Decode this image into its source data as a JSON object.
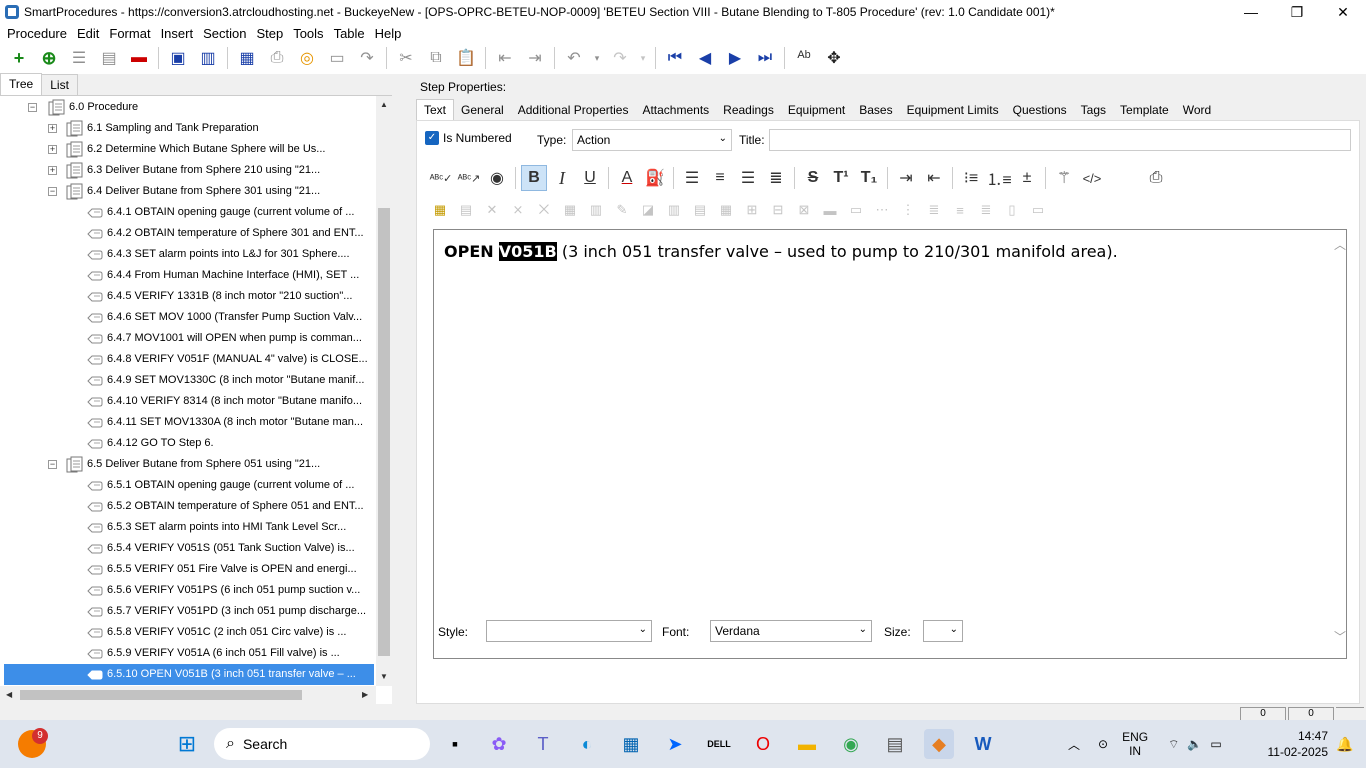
{
  "window": {
    "title": "SmartProcedures - https://conversion3.atrcloudhosting.net - BuckeyeNew - [OPS-OPRC-BETEU-NOP-0009] 'BETEU Section VIII - Butane Blending to T-805 Procedure' (rev: 1.0 Candidate 001)*"
  },
  "menu": [
    "Procedure",
    "Edit",
    "Format",
    "Insert",
    "Section",
    "Step",
    "Tools",
    "Table",
    "Help"
  ],
  "left_tabs": [
    "Tree",
    "List"
  ],
  "tree": [
    {
      "label": "6.0 Procedure",
      "level": 0,
      "exp": "−",
      "kind": "section"
    },
    {
      "label": "6.1 Sampling and Tank Preparation",
      "level": 1,
      "exp": "+",
      "kind": "section"
    },
    {
      "label": "6.2 Determine Which Butane Sphere will be Us...",
      "level": 1,
      "exp": "+",
      "kind": "section"
    },
    {
      "label": "6.3 Deliver Butane from Sphere 210 using \"21...",
      "level": 1,
      "exp": "+",
      "kind": "section"
    },
    {
      "label": "6.4 Deliver Butane from Sphere 301 using \"21...",
      "level": 1,
      "exp": "−",
      "kind": "section"
    },
    {
      "label": "6.4.1 OBTAIN opening gauge (current volume of ...",
      "level": 2,
      "kind": "step"
    },
    {
      "label": "6.4.2 OBTAIN temperature of Sphere 301 and ENT...",
      "level": 2,
      "kind": "step"
    },
    {
      "label": "6.4.3 SET alarm points into L&J for 301 Sphere....",
      "level": 2,
      "kind": "step"
    },
    {
      "label": "6.4.4 From Human Machine Interface (HMI), SET ...",
      "level": 2,
      "kind": "step"
    },
    {
      "label": "6.4.5 VERIFY 1331B (8 inch motor \"210 suction\"...",
      "level": 2,
      "kind": "step"
    },
    {
      "label": "6.4.6 SET MOV 1000 (Transfer Pump Suction Valv...",
      "level": 2,
      "kind": "step"
    },
    {
      "label": "6.4.7 MOV1001 will OPEN when pump is comman...",
      "level": 2,
      "kind": "step"
    },
    {
      "label": "6.4.8 VERIFY V051F (MANUAL 4\" valve) is CLOSE...",
      "level": 2,
      "kind": "step"
    },
    {
      "label": "6.4.9 SET MOV1330C (8 inch motor \"Butane manif...",
      "level": 2,
      "kind": "step"
    },
    {
      "label": "6.4.10 VERIFY 8314 (8 inch motor \"Butane manifo...",
      "level": 2,
      "kind": "step"
    },
    {
      "label": "6.4.11 SET MOV1330A (8 inch motor \"Butane man...",
      "level": 2,
      "kind": "step"
    },
    {
      "label": "6.4.12 GO TO Step 6.",
      "level": 2,
      "kind": "step"
    },
    {
      "label": "6.5 Deliver Butane from Sphere 051 using \"21...",
      "level": 1,
      "exp": "−",
      "kind": "section"
    },
    {
      "label": "6.5.1 OBTAIN opening gauge (current volume of ...",
      "level": 2,
      "kind": "step"
    },
    {
      "label": "6.5.2 OBTAIN temperature of Sphere 051 and ENT...",
      "level": 2,
      "kind": "step"
    },
    {
      "label": "6.5.3 SET alarm points into HMI Tank Level Scr...",
      "level": 2,
      "kind": "step"
    },
    {
      "label": "6.5.4 VERIFY V051S (051 Tank Suction Valve) is...",
      "level": 2,
      "kind": "step"
    },
    {
      "label": "6.5.5 VERIFY 051 Fire Valve is OPEN and energi...",
      "level": 2,
      "kind": "step"
    },
    {
      "label": "6.5.6 VERIFY V051PS (6 inch 051 pump suction v...",
      "level": 2,
      "kind": "step"
    },
    {
      "label": "6.5.7 VERIFY V051PD (3 inch 051 pump discharge...",
      "level": 2,
      "kind": "step"
    },
    {
      "label": "6.5.8 VERIFY V051C (2 inch 051 Circ valve) is ...",
      "level": 2,
      "kind": "step"
    },
    {
      "label": "6.5.9 VERIFY V051A (6 inch 051 Fill valve) is ...",
      "level": 2,
      "kind": "step"
    },
    {
      "label": "6.5.10 OPEN V051B (3 inch 051 transfer valve – ...",
      "level": 2,
      "kind": "step",
      "selected": true
    }
  ],
  "step_properties": {
    "heading": "Step Properties:",
    "tabs": [
      "Text",
      "General",
      "Additional Properties",
      "Attachments",
      "Readings",
      "Equipment",
      "Bases",
      "Equipment Limits",
      "Questions",
      "Tags",
      "Template",
      "Word"
    ],
    "is_numbered_label": "Is Numbered",
    "is_numbered": true,
    "type_label": "Type:",
    "type_value": "Action",
    "title_label": "Title:",
    "title_value": "",
    "editor": {
      "keyword": "OPEN",
      "highlight": "V051B",
      "rest": "(3 inch 051 transfer valve – used to pump to 210/301 manifold area)."
    },
    "style_label": "Style:",
    "style_value": "",
    "font_label": "Font:",
    "font_value": "Verdana",
    "size_label": "Size:",
    "size_value": ""
  },
  "statusbar": {
    "p1": "0",
    "p2": "0"
  },
  "taskbar": {
    "search_label": "Search",
    "notif_count": "9",
    "lang": "ENG",
    "region": "IN",
    "time": "14:47",
    "date": "11-02-2025"
  },
  "colors": {
    "selection": "#3d8ee8",
    "accent": "#1565c0"
  }
}
